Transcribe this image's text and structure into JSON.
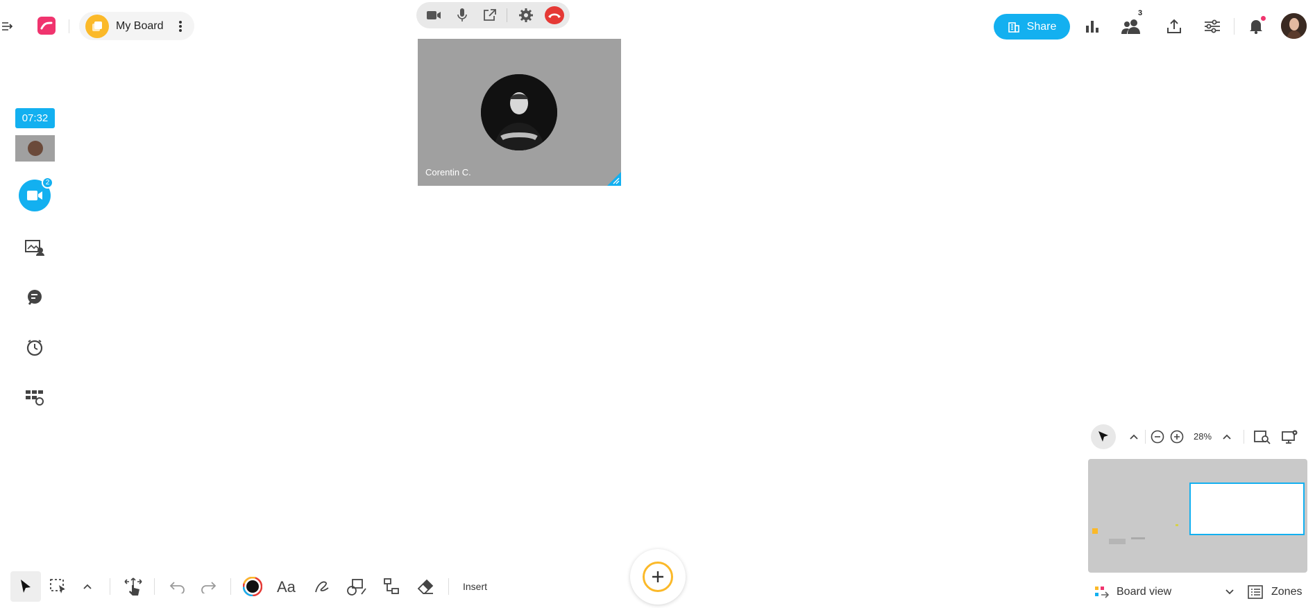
{
  "board": {
    "name": "My Board"
  },
  "video_tile": {
    "participant_name": "Corentin C."
  },
  "header": {
    "share_label": "Share",
    "participants_count": "3"
  },
  "sidebar": {
    "timer": "07:32",
    "video_call_badge": "2"
  },
  "toolbar": {
    "insert_label": "Insert"
  },
  "navigator": {
    "zoom": "28%",
    "board_view_label": "Board view",
    "zones_label": "Zones"
  },
  "colors": {
    "accent": "#13b0f0",
    "brand": "#f0346e",
    "board_icon": "#fbb929",
    "hangup": "#e53935"
  }
}
